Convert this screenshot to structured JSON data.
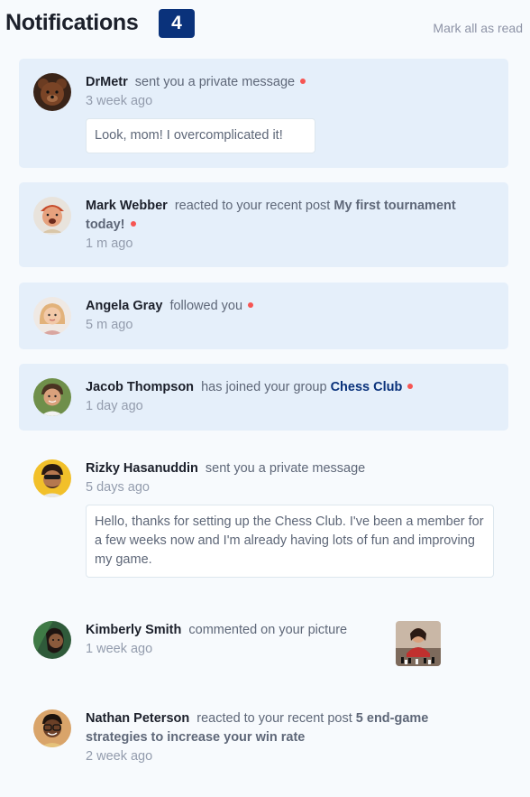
{
  "header": {
    "title": "Notifications",
    "unread_count": "4",
    "mark_all_label": "Mark all as read"
  },
  "notifications": [
    {
      "name": "DrMetr",
      "action": "sent you a private message",
      "time": "3 week ago",
      "message": "Look, mom! I overcomplicated it!",
      "unread": true
    },
    {
      "name": "Mark Webber",
      "action": "reacted to your recent post",
      "target": "My first tournament today!",
      "time": "1 m ago",
      "unread": true
    },
    {
      "name": "Angela Gray",
      "action": "followed you",
      "time": "5 m ago",
      "unread": true
    },
    {
      "name": "Jacob Thompson",
      "action": "has joined your group",
      "target": "Chess Club",
      "time": "1 day ago",
      "unread": true
    },
    {
      "name": "Rizky Hasanuddin",
      "action": "sent you a private message",
      "time": "5 days ago",
      "message": "Hello, thanks for setting up the Chess Club. I've been a member for a few weeks now and I'm already having lots of fun and improving my game.",
      "unread": false
    },
    {
      "name": "Kimberly Smith",
      "action": "commented on your picture",
      "time": "1 week ago",
      "unread": false
    },
    {
      "name": "Nathan Peterson",
      "action": "reacted to your recent post",
      "target": "5 end-game strategies to increase your win rate",
      "time": "2 week ago",
      "unread": false
    }
  ],
  "colors": {
    "unread_bg": "#e5effa",
    "badge_bg": "#0a327b",
    "unread_dot": "#f65552",
    "page_bg": "#f7fafd"
  }
}
